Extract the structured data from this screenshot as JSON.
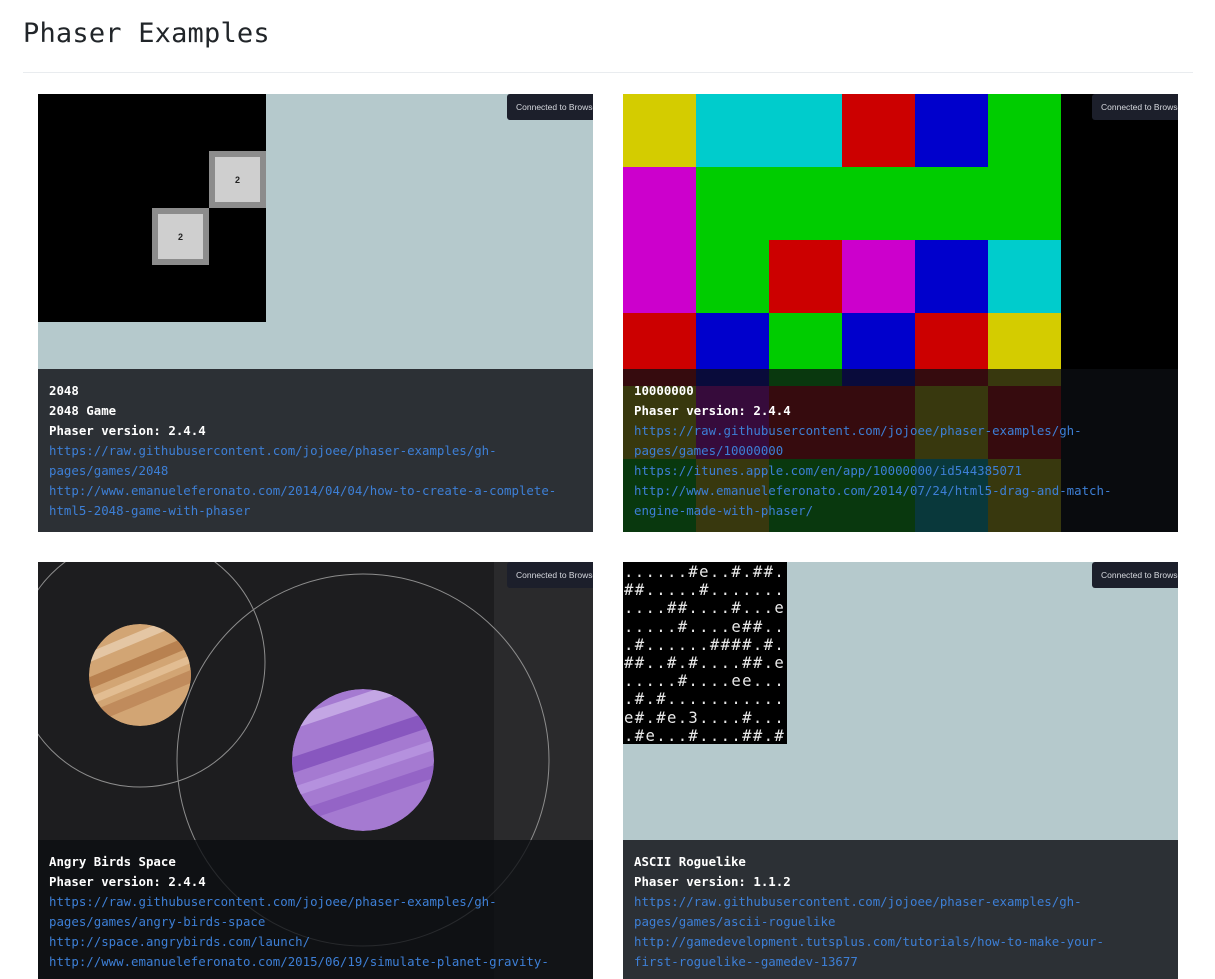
{
  "page": {
    "title": "Phaser Examples"
  },
  "badge_text": "Connected to Browse",
  "cards": [
    {
      "lines": [
        "2048",
        "2048 Game",
        "Phaser version: 2.4.4"
      ],
      "links": [
        "https://raw.githubusercontent.com/jojoee/phaser-examples/gh-\npages/games/2048",
        "http://www.emanueleferonato.com/2014/04/04/how-to-create-a-complete-\nhtml5-2048-game-with-phaser"
      ],
      "tiles": [
        "2",
        "2"
      ]
    },
    {
      "lines": [
        "10000000",
        "Phaser version: 2.4.4"
      ],
      "links": [
        "https://raw.githubusercontent.com/jojoee/phaser-examples/gh-\npages/games/10000000",
        "https://itunes.apple.com/en/app/10000000/id544385071",
        "http://www.emanueleferonato.com/2014/07/24/html5-drag-and-match-\nengine-made-with-phaser/"
      ],
      "colors": {
        "yellow": "#d4cc00",
        "cyan": "#00cccc",
        "red": "#cc0000",
        "blue": "#0000cc",
        "green": "#00cc00",
        "magenta": "#cc00cc"
      }
    },
    {
      "lines": [
        "Angry Birds Space",
        "Phaser version: 2.4.4"
      ],
      "links": [
        "https://raw.githubusercontent.com/jojoee/phaser-examples/gh-\npages/games/angry-birds-space",
        "http://space.angrybirds.com/launch/",
        "http://www.emanueleferonato.com/2015/06/19/simulate-planet-gravity-"
      ]
    },
    {
      "lines": [
        "ASCII Roguelike",
        "Phaser version: 1.1.2"
      ],
      "links": [
        "https://raw.githubusercontent.com/jojoee/phaser-examples/gh-\npages/games/ascii-roguelike",
        "http://gamedevelopment.tutsplus.com/tutorials/how-to-make-your-\nfirst-roguelike--gamedev-13677"
      ],
      "ascii_map": "......#e..#.##.\n##.....#.......\n....##....#...e\n.....#....e##..\n.#......####.#.\n##..#.#....##.e\n.....#....ee...\n.#.#...........\ne#.#e.3....#...\n.#e...#....##.#"
    }
  ]
}
